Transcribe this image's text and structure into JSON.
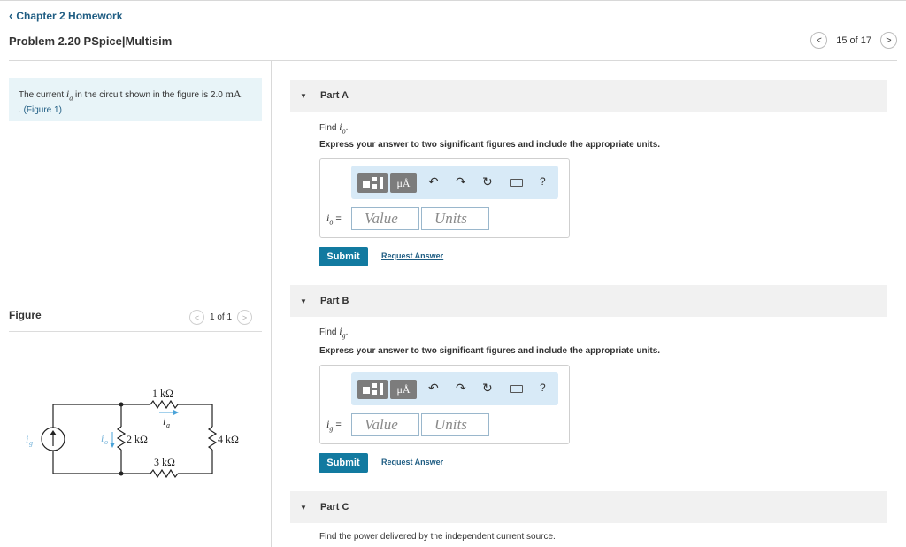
{
  "header": {
    "back_label": "Chapter 2 Homework",
    "title": "Problem 2.20 PSpice|Multisim",
    "nav_count": "15 of 17"
  },
  "intro": {
    "text_before": "The current ",
    "var_sym": "i",
    "var_sub": "a",
    "text_mid": " in the circuit shown in the figure is 2.0 ",
    "value_unit": "mA",
    "text_after": ". ",
    "figure_link": "(Figure 1)"
  },
  "figure": {
    "label": "Figure",
    "count": "1 of 1",
    "circuit": {
      "r1": "1 kΩ",
      "ia": "i",
      "ia_sub": "a",
      "ig": "i",
      "ig_sub": "g",
      "io": "i",
      "io_sub": "o",
      "r2": "2 kΩ",
      "r3": "3 kΩ",
      "r4": "4 kΩ"
    }
  },
  "parts": [
    {
      "label": "Part A",
      "find_prefix": "Find ",
      "find_sym": "i",
      "find_sub": "o",
      "find_suffix": ".",
      "instruction": "Express your answer to two significant figures and include the appropriate units.",
      "var_sym": "i",
      "var_sub": "o",
      "equals": " =",
      "value_placeholder": "Value",
      "units_placeholder": "Units",
      "submit_label": "Submit",
      "request_label": "Request Answer"
    },
    {
      "label": "Part B",
      "find_prefix": "Find ",
      "find_sym": "i",
      "find_sub": "g",
      "find_suffix": ".",
      "instruction": "Express your answer to two significant figures and include the appropriate units.",
      "var_sym": "i",
      "var_sub": "g",
      "equals": " =",
      "value_placeholder": "Value",
      "units_placeholder": "Units",
      "submit_label": "Submit",
      "request_label": "Request Answer"
    },
    {
      "label": "Part C",
      "text": "Find the power delivered by the independent current source."
    }
  ],
  "toolbar": {
    "units_glyph": "μÅ",
    "undo_glyph": "↶",
    "redo_glyph": "↷",
    "reset_glyph": "↻",
    "help_glyph": "?"
  },
  "colors": {
    "accent": "#127aa0",
    "link": "#1f5d83",
    "intro_bg": "#e8f4f8",
    "toolbar_bg": "#d8eaf7"
  }
}
